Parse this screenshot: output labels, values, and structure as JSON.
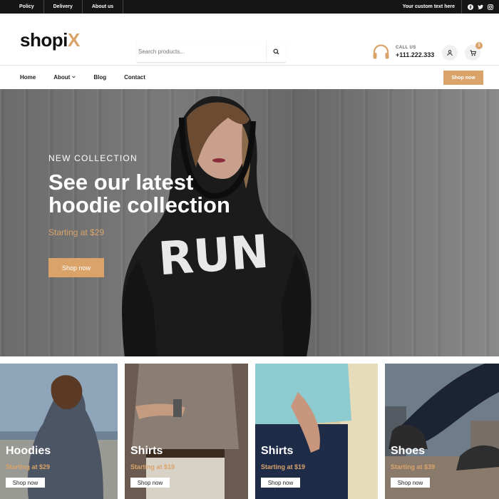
{
  "topbar": {
    "links": [
      "Policy",
      "Delivery",
      "About us"
    ],
    "custom_text": "Your custom text here",
    "social_icons": [
      "facebook-icon",
      "twitter-icon",
      "instagram-icon"
    ]
  },
  "header": {
    "logo_main": "shopi",
    "logo_accent": "X",
    "search_placeholder": "Search products...",
    "call_label": "CALL US",
    "call_number": "+111.222.333",
    "cart_count": "1"
  },
  "nav": {
    "items": [
      "Home",
      "About",
      "Blog",
      "Contact"
    ],
    "button": "Shop now"
  },
  "hero": {
    "kicker": "NEW COLLECTION",
    "headline": "See our latest hoodie collection",
    "price": "Starting at $29",
    "button": "Shop now",
    "shirt_text": "RUN"
  },
  "categories": [
    {
      "title": "Hoodies",
      "price": "Starting at $29",
      "button": "Shop now"
    },
    {
      "title": "Shirts",
      "price": "Starting at $19",
      "button": "Shop now"
    },
    {
      "title": "Shirts",
      "price": "Starting at $19",
      "button": "Shop now"
    },
    {
      "title": "Shoes",
      "price": "Starting at $39",
      "button": "Shop now"
    }
  ],
  "colors": {
    "accent": "#d9a36a",
    "topbar": "#151515"
  }
}
